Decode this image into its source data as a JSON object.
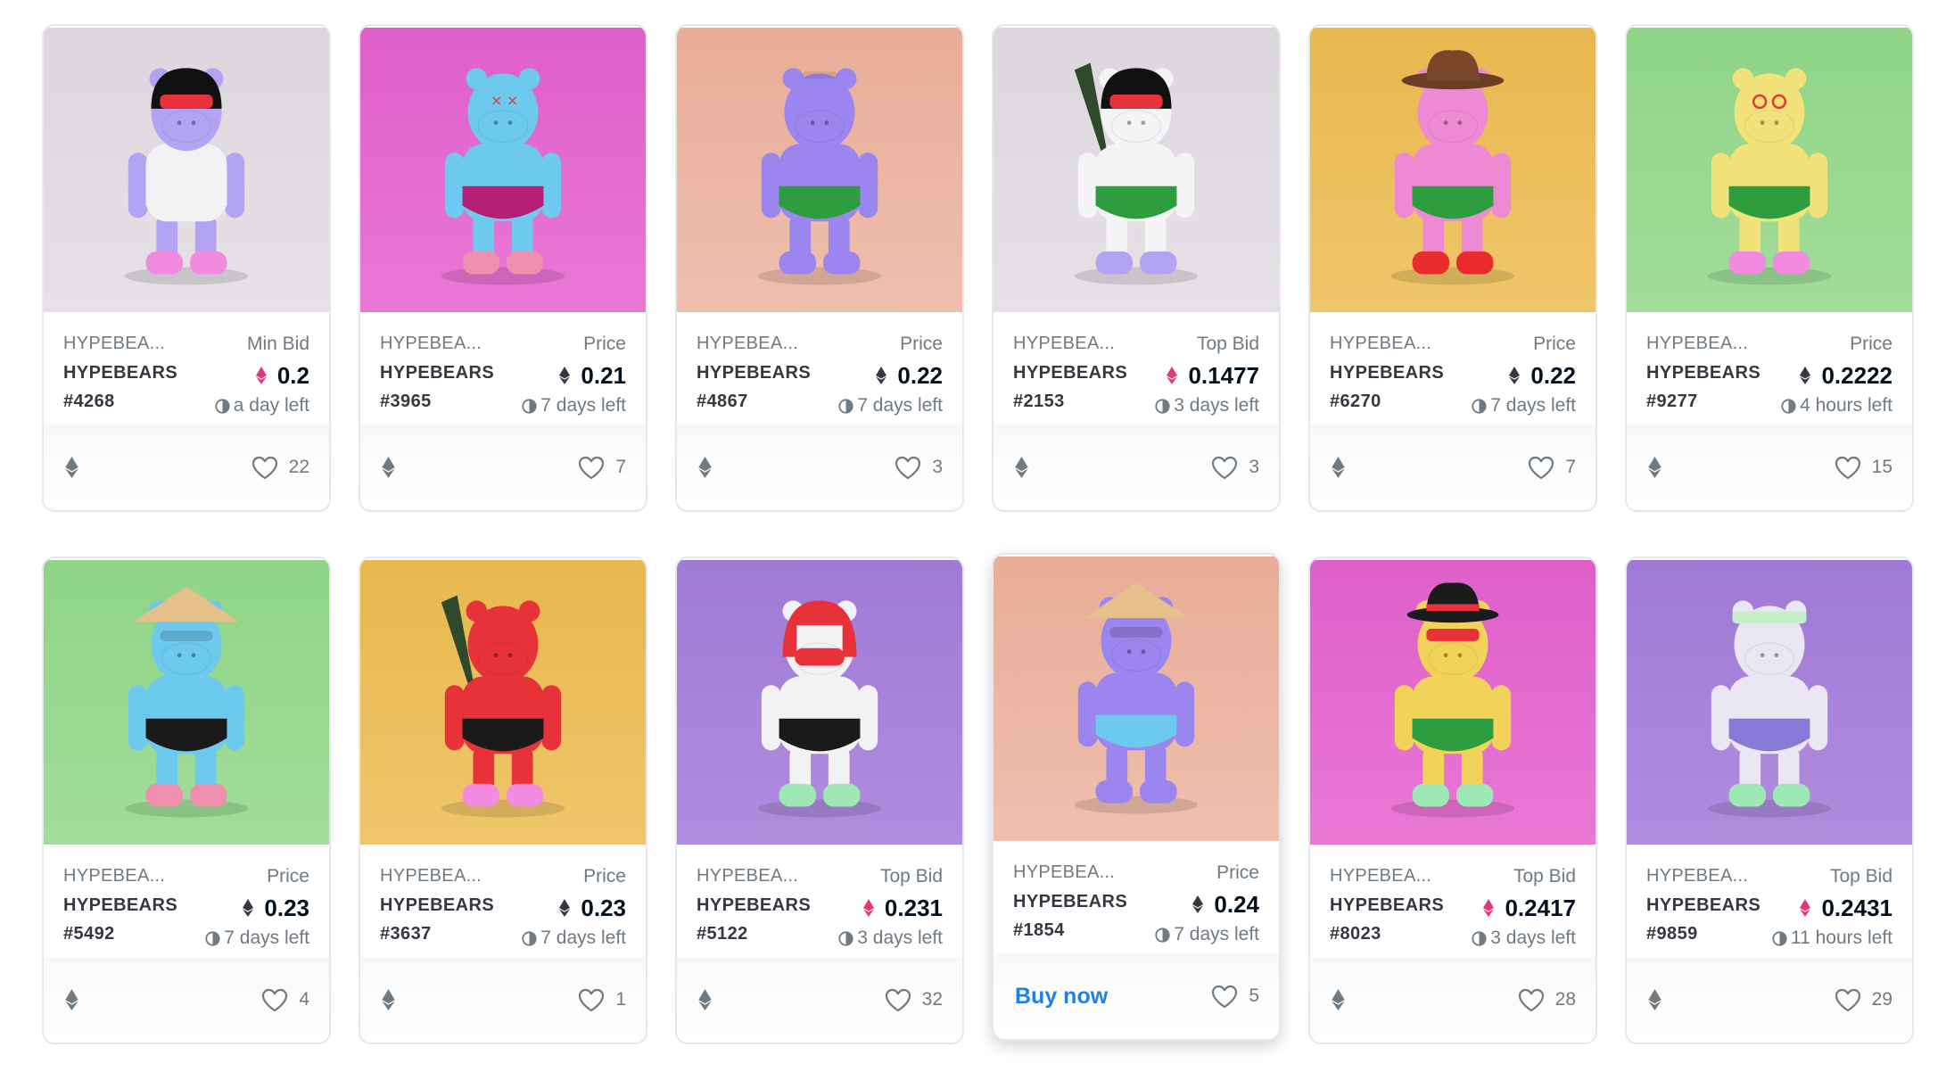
{
  "cards": [
    {
      "collection": "HYPEBEA...",
      "title": "HYPEBEARS",
      "number": "#4268",
      "price_label": "Min Bid",
      "price": "0.2",
      "price_token": "weth",
      "time": "a day left",
      "likes": "22",
      "footer_action": "",
      "bg": "#dcd7dc",
      "floor": "#e6e1e6",
      "body": "#b2a4f2",
      "torso": "#f2f2f4",
      "shorts": "#f2f2f4",
      "feet": "#f28ae0",
      "accessory": "helmet"
    },
    {
      "collection": "HYPEBEA...",
      "title": "HYPEBEARS",
      "number": "#3965",
      "price_label": "Price",
      "price": "0.21",
      "price_token": "eth",
      "time": "7 days left",
      "likes": "7",
      "footer_action": "",
      "bg": "#df5fc9",
      "floor": "#e978d5",
      "body": "#6dc9ee",
      "torso": "#6dc9ee",
      "shorts": "#b51f75",
      "feet": "#ef8fb0",
      "accessory": "x-eyes"
    },
    {
      "collection": "HYPEBEA...",
      "title": "HYPEBEARS",
      "number": "#4867",
      "price_label": "Price",
      "price": "0.22",
      "price_token": "eth",
      "time": "7 days left",
      "likes": "3",
      "footer_action": "",
      "bg": "#e8ad97",
      "floor": "#efbfae",
      "body": "#9b85ee",
      "torso": "#9b85ee",
      "shorts": "#2e9d3f",
      "feet": "#9b85ee",
      "accessory": "none"
    },
    {
      "collection": "HYPEBEA...",
      "title": "HYPEBEARS",
      "number": "#2153",
      "price_label": "Top Bid",
      "price": "0.1477",
      "price_token": "weth",
      "time": "3 days left",
      "likes": "3",
      "footer_action": "",
      "bg": "#dcd7dc",
      "floor": "#e6e1e6",
      "body": "#f4f4f6",
      "torso": "#f4f4f6",
      "shorts": "#2e9d3f",
      "feet": "#b2a4f2",
      "accessory": "helmet-knife"
    },
    {
      "collection": "HYPEBEA...",
      "title": "HYPEBEARS",
      "number": "#6270",
      "price_label": "Price",
      "price": "0.22",
      "price_token": "eth",
      "time": "7 days left",
      "likes": "7",
      "footer_action": "",
      "bg": "#e8b84f",
      "floor": "#efc66a",
      "body": "#ee8ad3",
      "torso": "#ee8ad3",
      "shorts": "#2e9d3f",
      "feet": "#ea2c2c",
      "accessory": "cowboy"
    },
    {
      "collection": "HYPEBEA...",
      "title": "HYPEBEARS",
      "number": "#9277",
      "price_label": "Price",
      "price": "0.2222",
      "price_token": "eth",
      "time": "4 hours left",
      "likes": "15",
      "footer_action": "",
      "bg": "#8fd487",
      "floor": "#a2dd9a",
      "body": "#f2e27a",
      "torso": "#f2e27a",
      "shorts": "#2e9d3f",
      "feet": "#f28ae0",
      "accessory": "spiral-eyes"
    },
    {
      "collection": "HYPEBEA...",
      "title": "HYPEBEARS",
      "number": "#5492",
      "price_label": "Price",
      "price": "0.23",
      "price_token": "eth",
      "time": "7 days left",
      "likes": "4",
      "footer_action": "",
      "bg": "#8fd487",
      "floor": "#a2dd9a",
      "body": "#6dc9ee",
      "torso": "#6dc9ee",
      "shorts": "#1a1a1a",
      "feet": "#ef8fb0",
      "accessory": "straw-hat"
    },
    {
      "collection": "HYPEBEA...",
      "title": "HYPEBEARS",
      "number": "#3637",
      "price_label": "Price",
      "price": "0.23",
      "price_token": "eth",
      "time": "7 days left",
      "likes": "1",
      "footer_action": "",
      "bg": "#e8b84f",
      "floor": "#efc66a",
      "body": "#e8323a",
      "torso": "#e8323a",
      "shorts": "#1a1a1a",
      "feet": "#f28ae0",
      "accessory": "knife"
    },
    {
      "collection": "HYPEBEA...",
      "title": "HYPEBEARS",
      "number": "#5122",
      "price_label": "Top Bid",
      "price": "0.231",
      "price_token": "weth",
      "time": "3 days left",
      "likes": "32",
      "footer_action": "",
      "bg": "#a07ad6",
      "floor": "#b08ddf",
      "body": "#f2f2f4",
      "torso": "#f2f2f4",
      "shorts": "#1a1a1a",
      "feet": "#9ee8b5",
      "accessory": "boxing-helmet"
    },
    {
      "collection": "HYPEBEA...",
      "title": "HYPEBEARS",
      "number": "#1854",
      "price_label": "Price",
      "price": "0.24",
      "price_token": "eth",
      "time": "7 days left",
      "likes": "5",
      "footer_action": "Buy now",
      "bg": "#e8ad97",
      "floor": "#efbfae",
      "body": "#9b85ee",
      "torso": "#9b85ee",
      "shorts": "#6dc9ee",
      "feet": "#9b85ee",
      "accessory": "straw-hat"
    },
    {
      "collection": "HYPEBEA...",
      "title": "HYPEBEARS",
      "number": "#8023",
      "price_label": "Top Bid",
      "price": "0.2417",
      "price_token": "weth",
      "time": "3 days left",
      "likes": "28",
      "footer_action": "",
      "bg": "#df5fc9",
      "floor": "#e978d5",
      "body": "#f2d35a",
      "torso": "#f2d35a",
      "shorts": "#2e9d3f",
      "feet": "#9ee8b5",
      "accessory": "fedora"
    },
    {
      "collection": "HYPEBEA...",
      "title": "HYPEBEARS",
      "number": "#9859",
      "price_label": "Top Bid",
      "price": "0.2431",
      "price_token": "weth",
      "time": "11 hours left",
      "likes": "29",
      "footer_action": "",
      "bg": "#a07ad6",
      "floor": "#b08ddf",
      "body": "#ebe6f3",
      "torso": "#ebe6f3",
      "shorts": "#8a7ad8",
      "feet": "#9ee8b5",
      "accessory": "visor"
    }
  ],
  "colors": {
    "eth": "#353840",
    "weth": "#e2387a",
    "buy_now": "#2081e2",
    "muted": "#707a83"
  },
  "hovered_card": 9
}
